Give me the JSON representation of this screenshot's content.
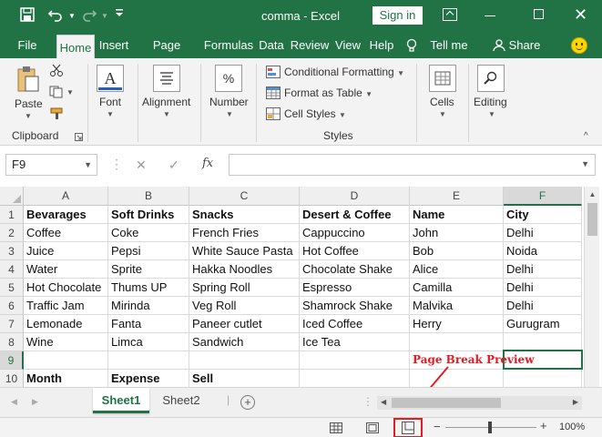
{
  "title_bar": {
    "title": "comma  -  Excel",
    "sign_in_label": "Sign in",
    "accent_color": "#217346"
  },
  "tabs": [
    "File",
    "Home",
    "Insert",
    "Page Layout",
    "Formulas",
    "Data",
    "Review",
    "View",
    "Help"
  ],
  "tell_me": "Tell me",
  "share": "Share",
  "ribbon": {
    "paste_label": "Paste",
    "clipboard_label": "Clipboard",
    "font_label": "Font",
    "alignment_label": "Alignment",
    "number_label": "Number",
    "number_icon": "%",
    "conditional_formatting": "Conditional Formatting",
    "format_as_table": "Format as Table",
    "cell_styles": "Cell Styles",
    "styles_label": "Styles",
    "cells_label": "Cells",
    "editing_label": "Editing"
  },
  "formula_bar": {
    "name_box": "F9",
    "fx_label": "fx",
    "formula": ""
  },
  "columns": [
    "A",
    "B",
    "C",
    "D",
    "E",
    "F"
  ],
  "rows": [
    [
      "Bevarages",
      "Soft Drinks",
      "Snacks",
      "Desert & Coffee",
      "Name",
      "City"
    ],
    [
      "Coffee",
      "Coke",
      "French Fries",
      "Cappuccino",
      "John",
      "Delhi"
    ],
    [
      "Juice",
      "Pepsi",
      "White Sauce Pasta",
      "Hot Coffee",
      "Bob",
      "Noida"
    ],
    [
      "Water",
      "Sprite",
      "Hakka Noodles",
      "Chocolate Shake",
      "Alice",
      "Delhi"
    ],
    [
      "Hot Chocolate",
      "Thums UP",
      "Spring Roll",
      "Espresso",
      "Camilla",
      "Delhi"
    ],
    [
      "Traffic Jam",
      "Mirinda",
      "Veg Roll",
      "Shamrock Shake",
      "Malvika",
      "Delhi"
    ],
    [
      "Lemonade",
      "Fanta",
      "Paneer cutlet",
      "Iced Coffee",
      "Herry",
      "Gurugram"
    ],
    [
      "Wine",
      "Limca",
      "Sandwich",
      "Ice Tea",
      "",
      ""
    ],
    [
      "",
      "",
      "",
      "",
      "",
      ""
    ],
    [
      "Month",
      "Expense",
      "Sell",
      "",
      "",
      ""
    ]
  ],
  "row_numbers": [
    "1",
    "2",
    "3",
    "4",
    "5",
    "6",
    "7",
    "8",
    "9",
    "10"
  ],
  "annotation": "Page Break Preview",
  "sheets": [
    "Sheet1",
    "Sheet2"
  ],
  "status": {
    "zoom": "100%"
  }
}
